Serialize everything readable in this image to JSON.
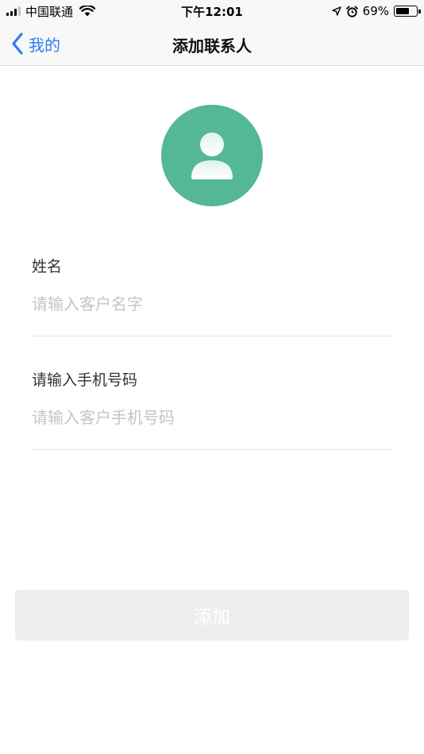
{
  "status_bar": {
    "carrier": "中国联通",
    "time": "下午12:01",
    "battery_percent": "69%",
    "battery_level": 0.69
  },
  "nav": {
    "back_label": "我的",
    "title": "添加联系人"
  },
  "form": {
    "name": {
      "label": "姓名",
      "placeholder": "请输入客户名字",
      "value": ""
    },
    "phone": {
      "label": "请输入手机号码",
      "placeholder": "请输入客户手机号码",
      "value": ""
    }
  },
  "submit": {
    "label": "添加"
  },
  "colors": {
    "accent": "#2f7cf6",
    "avatar_bg": "#54b894",
    "button_bg": "#eeeeee",
    "placeholder": "#c4c4c4"
  },
  "icons": {
    "back": "chevron-left-icon",
    "avatar": "person-icon",
    "wifi": "wifi-icon",
    "location": "location-arrow-icon",
    "alarm": "alarm-icon",
    "battery": "battery-icon",
    "signal": "signal-icon"
  }
}
